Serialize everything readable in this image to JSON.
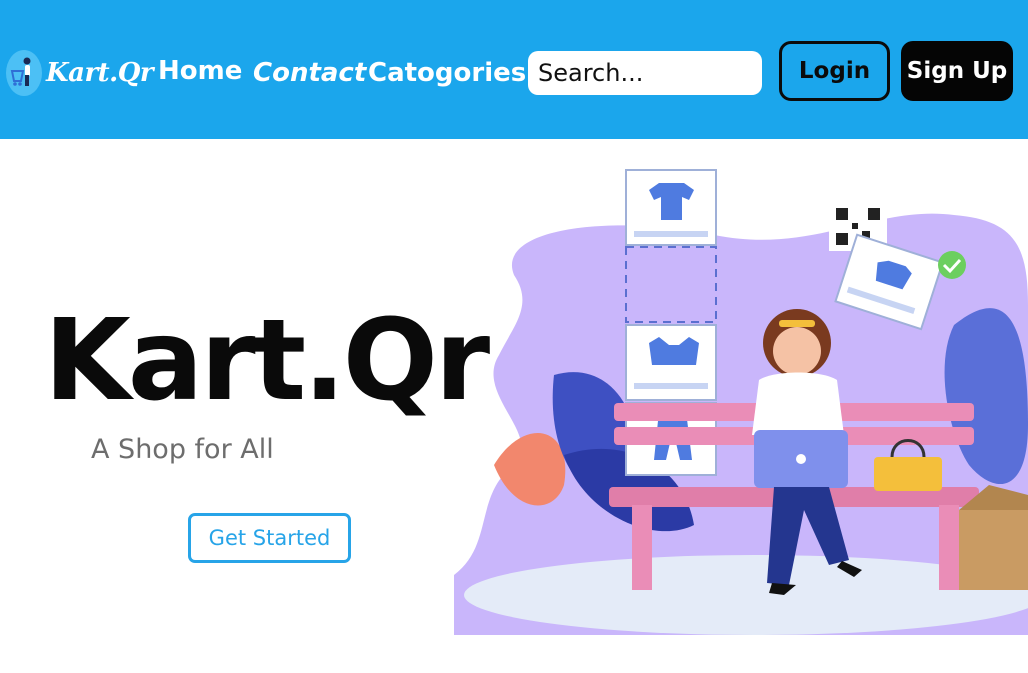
{
  "navbar": {
    "logo_text": "Kart.Qr",
    "links": [
      {
        "label": "Home"
      },
      {
        "label": "Contact"
      },
      {
        "label": "Catogories"
      }
    ],
    "search_placeholder": "Search...",
    "login_label": "Login",
    "signup_label": "Sign Up"
  },
  "hero": {
    "title": "Kart.Qr",
    "subtitle": "A Shop for All",
    "cta_label": "Get Started"
  },
  "colors": {
    "navbar_bg": "#1ba6ec",
    "accent": "#27a4e8",
    "illustration_purple": "#c9b6fb",
    "illustration_pink": "#e58bb0"
  }
}
